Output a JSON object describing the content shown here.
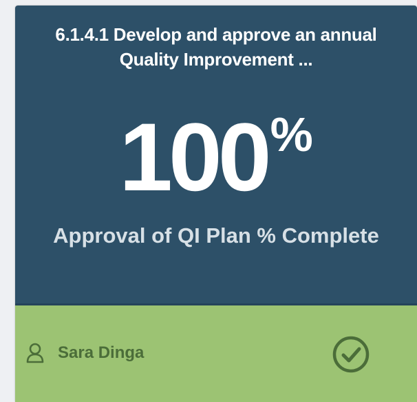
{
  "card": {
    "title": "6.1.4.1 Develop and approve an annual Quality Improvement ...",
    "value": "100",
    "unit": "%",
    "label": "Approval of QI Plan % Complete",
    "owner": "Sara Dinga",
    "status": "complete",
    "colors": {
      "header_bg": "#2d5068",
      "footer_bg": "#9cc373",
      "footer_text": "#4b6d39"
    }
  }
}
